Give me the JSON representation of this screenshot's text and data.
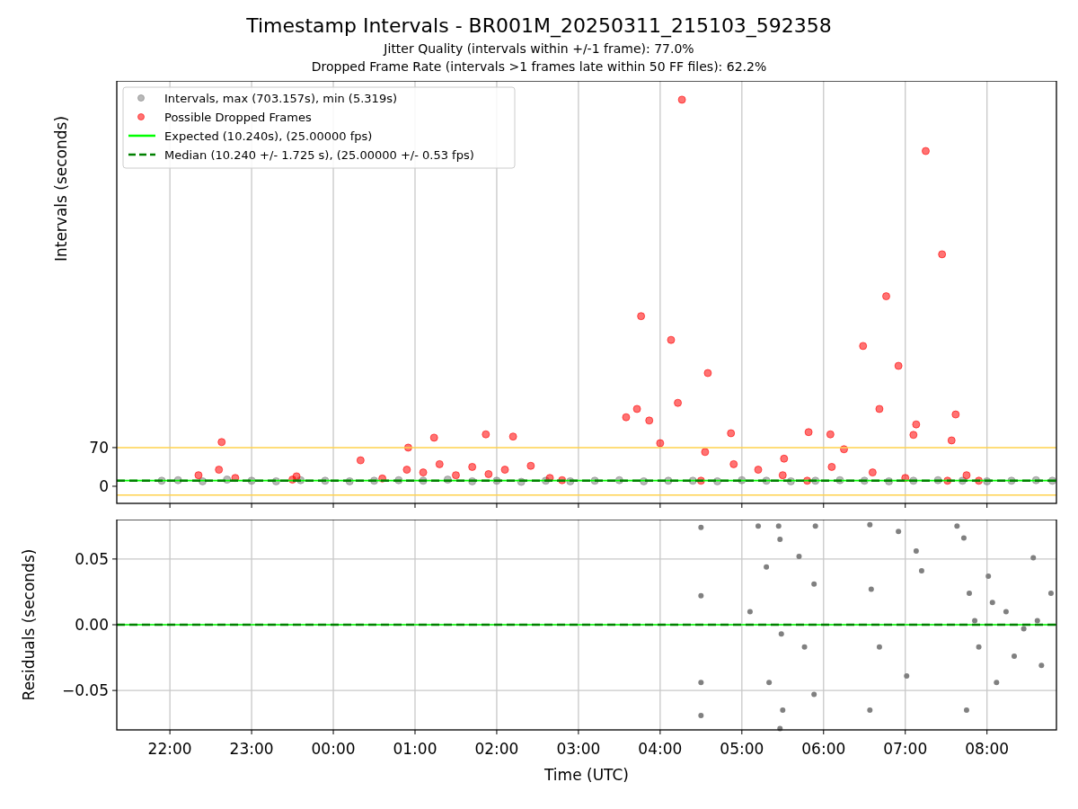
{
  "title": "Timestamp Intervals - BR001M_20250311_215103_592358",
  "subtitles": [
    "Jitter Quality (intervals within +/-1 frame): 77.0%",
    "Dropped Frame Rate (intervals >1 frames late within 50 FF files): 62.2%"
  ],
  "intervals_chart": {
    "chart_data": {
      "type": "scatter",
      "ylabel": "Intervals (seconds)",
      "xlim": [
        "2025-03-11T21:21",
        "2025-03-12T08:51"
      ],
      "ylim": [
        -31,
        734
      ],
      "yticks": [
        {
          "value": 0,
          "label": "0"
        },
        {
          "value": 70,
          "label": "70"
        }
      ],
      "grid": true,
      "legend": "upper left",
      "ref_lines": [
        {
          "axis": "y",
          "value": 10.24,
          "label": "Expected (10.240s), (25.00000 fps)",
          "color": "#00ff00"
        },
        {
          "axis": "y",
          "value": 10.24,
          "label": "Median (10.240 +/- 1.725 s), (25.00000 +/- 0.53 fps)",
          "color": "#008000"
        },
        {
          "axis": "y",
          "value": 70,
          "color": "#ffd24d"
        },
        {
          "axis": "y",
          "value": -16,
          "color": "#ffd24d"
        }
      ],
      "series": [
        {
          "name": "Intervals, max (703.157s), min (5.319s)",
          "color": "#808080",
          "x": [
            "2025-03-11T21:54",
            "2025-03-11T22:06",
            "2025-03-11T22:24",
            "2025-03-11T22:42",
            "2025-03-11T23:00",
            "2025-03-11T23:18",
            "2025-03-11T23:36",
            "2025-03-11T23:54",
            "2025-03-12T00:12",
            "2025-03-12T00:30",
            "2025-03-12T00:48",
            "2025-03-12T01:06",
            "2025-03-12T01:24",
            "2025-03-12T01:42",
            "2025-03-12T02:00",
            "2025-03-12T02:18",
            "2025-03-12T02:36",
            "2025-03-12T02:54",
            "2025-03-12T03:12",
            "2025-03-12T03:30",
            "2025-03-12T03:48",
            "2025-03-12T04:06",
            "2025-03-12T04:24",
            "2025-03-12T04:42",
            "2025-03-12T05:00",
            "2025-03-12T05:18",
            "2025-03-12T05:36",
            "2025-03-12T05:54",
            "2025-03-12T06:12",
            "2025-03-12T06:30",
            "2025-03-12T06:48",
            "2025-03-12T07:06",
            "2025-03-12T07:24",
            "2025-03-12T07:42",
            "2025-03-12T08:00",
            "2025-03-12T08:18",
            "2025-03-12T08:36",
            "2025-03-12T08:48"
          ],
          "values": [
            10,
            11,
            9,
            12,
            10,
            9,
            11,
            10,
            9,
            10,
            11,
            10,
            12,
            9,
            10,
            8,
            10,
            9,
            10,
            11,
            9,
            10,
            10,
            9,
            11,
            10,
            9,
            10,
            11,
            10,
            9,
            10,
            11,
            10,
            9,
            10,
            11,
            10
          ]
        },
        {
          "name": "Possible Dropped Frames",
          "color": "#ff0000",
          "x": [
            "2025-03-12T04:16",
            "2025-03-12T07:15",
            "2025-03-12T07:27",
            "2025-03-12T06:46",
            "2025-03-12T03:46",
            "2025-03-12T04:08",
            "2025-03-12T06:29",
            "2025-03-12T04:35",
            "2025-03-12T06:55",
            "2025-03-12T04:13",
            "2025-03-12T07:08",
            "2025-03-12T03:35",
            "2025-03-12T03:43",
            "2025-03-12T03:52",
            "2025-03-12T06:41",
            "2025-03-12T07:37",
            "2025-03-11T22:38",
            "2025-03-12T01:14",
            "2025-03-12T01:52",
            "2025-03-12T02:12",
            "2025-03-12T00:55",
            "2025-03-12T05:49",
            "2025-03-12T06:05",
            "2025-03-12T04:52",
            "2025-03-12T04:00",
            "2025-03-12T04:33",
            "2025-03-12T05:31",
            "2025-03-12T00:20",
            "2025-03-12T07:06",
            "2025-03-12T07:34",
            "2025-03-12T06:15",
            "2025-03-12T02:25",
            "2025-03-12T02:48",
            "2025-03-11T22:21",
            "2025-03-11T22:36",
            "2025-03-11T22:48",
            "2025-03-11T23:30",
            "2025-03-11T23:33",
            "2025-03-12T00:36",
            "2025-03-12T00:54",
            "2025-03-12T01:06",
            "2025-03-12T01:18",
            "2025-03-12T01:30",
            "2025-03-12T01:42",
            "2025-03-12T01:54",
            "2025-03-12T02:06",
            "2025-03-12T02:39",
            "2025-03-12T04:30",
            "2025-03-12T04:54",
            "2025-03-12T05:12",
            "2025-03-12T05:30",
            "2025-03-12T05:48",
            "2025-03-12T06:06",
            "2025-03-12T06:36",
            "2025-03-12T07:00",
            "2025-03-12T07:31",
            "2025-03-12T07:45",
            "2025-03-12T07:54"
          ],
          "values": [
            700,
            607,
            420,
            344,
            308,
            265,
            254,
            205,
            218,
            151,
            112,
            125,
            140,
            119,
            140,
            130,
            80,
            88,
            94,
            90,
            70,
            98,
            94,
            96,
            78,
            62,
            50,
            47,
            93,
            83,
            67,
            37,
            11,
            20,
            30,
            15,
            12,
            18,
            14,
            30,
            25,
            40,
            20,
            35,
            22,
            30,
            15,
            10,
            40,
            30,
            20,
            10,
            35,
            25,
            15,
            10,
            20,
            10
          ]
        }
      ]
    }
  },
  "residuals_chart": {
    "chart_data": {
      "type": "scatter",
      "xlabel": "Time (UTC)",
      "ylabel": "Residuals (seconds)",
      "xlim": [
        "2025-03-11T21:21",
        "2025-03-12T08:51"
      ],
      "ylim": [
        -0.08,
        0.08
      ],
      "grid": true,
      "xticks": [
        {
          "value": "2025-03-11T22:00",
          "label": "22:00"
        },
        {
          "value": "2025-03-11T23:00",
          "label": "23:00"
        },
        {
          "value": "2025-03-12T00:00",
          "label": "00:00"
        },
        {
          "value": "2025-03-12T01:00",
          "label": "01:00"
        },
        {
          "value": "2025-03-12T02:00",
          "label": "02:00"
        },
        {
          "value": "2025-03-12T03:00",
          "label": "03:00"
        },
        {
          "value": "2025-03-12T04:00",
          "label": "04:00"
        },
        {
          "value": "2025-03-12T05:00",
          "label": "05:00"
        },
        {
          "value": "2025-03-12T06:00",
          "label": "06:00"
        },
        {
          "value": "2025-03-12T07:00",
          "label": "07:00"
        },
        {
          "value": "2025-03-12T08:00",
          "label": "08:00"
        }
      ],
      "yticks": [
        {
          "value": 0.05,
          "label": "0.05"
        },
        {
          "value": 0,
          "label": "0.00"
        },
        {
          "value": -0.05,
          "label": "−0.05"
        }
      ],
      "ref_lines": [
        {
          "axis": "y",
          "value": 0,
          "color": "#00ff00"
        },
        {
          "axis": "y",
          "value": 0,
          "color": "#008000"
        }
      ],
      "series": [
        {
          "color": "#808080",
          "x": [
            "2025-03-12T04:30",
            "2025-03-12T04:30",
            "2025-03-12T04:30",
            "2025-03-12T04:30",
            "2025-03-12T05:12",
            "2025-03-12T05:27",
            "2025-03-12T05:28",
            "2025-03-12T05:18",
            "2025-03-12T05:42",
            "2025-03-12T05:54",
            "2025-03-12T05:53",
            "2025-03-12T05:06",
            "2025-03-12T05:29",
            "2025-03-12T05:20",
            "2025-03-12T05:30",
            "2025-03-12T05:28",
            "2025-03-12T05:53",
            "2025-03-12T05:46",
            "2025-03-12T06:34",
            "2025-03-12T06:55",
            "2025-03-12T06:35",
            "2025-03-12T06:41",
            "2025-03-12T06:34",
            "2025-03-12T07:01",
            "2025-03-12T07:08",
            "2025-03-12T07:12",
            "2025-03-12T07:38",
            "2025-03-12T07:43",
            "2025-03-12T07:47",
            "2025-03-12T08:01",
            "2025-03-12T08:14",
            "2025-03-12T08:27",
            "2025-03-12T08:40",
            "2025-03-12T07:54",
            "2025-03-12T08:07",
            "2025-03-12T07:45",
            "2025-03-12T08:34",
            "2025-03-12T08:47",
            "2025-03-12T08:20",
            "2025-03-12T07:51",
            "2025-03-12T08:04",
            "2025-03-12T08:37"
          ],
          "values": [
            0.074,
            0.022,
            -0.044,
            -0.069,
            0.075,
            0.075,
            0.065,
            0.044,
            0.052,
            0.075,
            0.031,
            0.01,
            -0.007,
            -0.044,
            -0.065,
            -0.079,
            -0.053,
            -0.017,
            0.076,
            0.071,
            0.027,
            -0.017,
            -0.065,
            -0.039,
            0.056,
            0.041,
            0.075,
            0.066,
            0.024,
            0.037,
            0.01,
            -0.003,
            -0.031,
            -0.017,
            -0.044,
            -0.065,
            0.051,
            0.024,
            -0.024,
            0.003,
            0.017,
            0.003
          ]
        }
      ]
    }
  }
}
